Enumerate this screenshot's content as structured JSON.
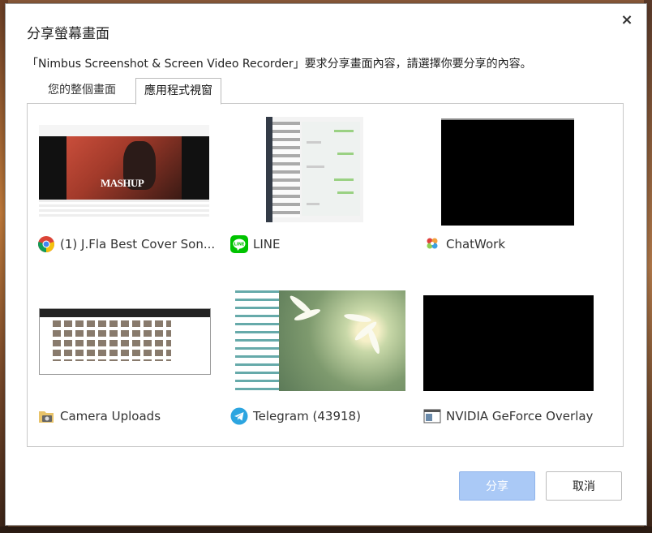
{
  "dialog": {
    "title": "分享螢幕畫面",
    "description": "「Nimbus Screenshot & Screen Video Recorder」要求分享畫面內容，請選擇你要分享的內容。",
    "close_label": "×"
  },
  "tabs": [
    {
      "label": "您的整個畫面",
      "selected": false
    },
    {
      "label": "應用程式視窗",
      "selected": true
    }
  ],
  "windows": [
    {
      "label": "(1) J.Fla Best Cover Son...",
      "icon": "chrome-icon",
      "thumb_text": "MASHUP"
    },
    {
      "label": "LINE",
      "icon": "line-icon"
    },
    {
      "label": "ChatWork",
      "icon": "chatwork-icon"
    },
    {
      "label": "Camera Uploads",
      "icon": "folder-icon"
    },
    {
      "label": "Telegram (43918)",
      "icon": "telegram-icon"
    },
    {
      "label": "NVIDIA GeForce Overlay",
      "icon": "nvidia-window-icon"
    }
  ],
  "buttons": {
    "share": "分享",
    "cancel": "取消"
  },
  "colors": {
    "share_button": "#aac9f6",
    "line_green": "#00c300",
    "telegram_blue": "#2ca5e0",
    "chatwork_red": "#e0403c"
  }
}
